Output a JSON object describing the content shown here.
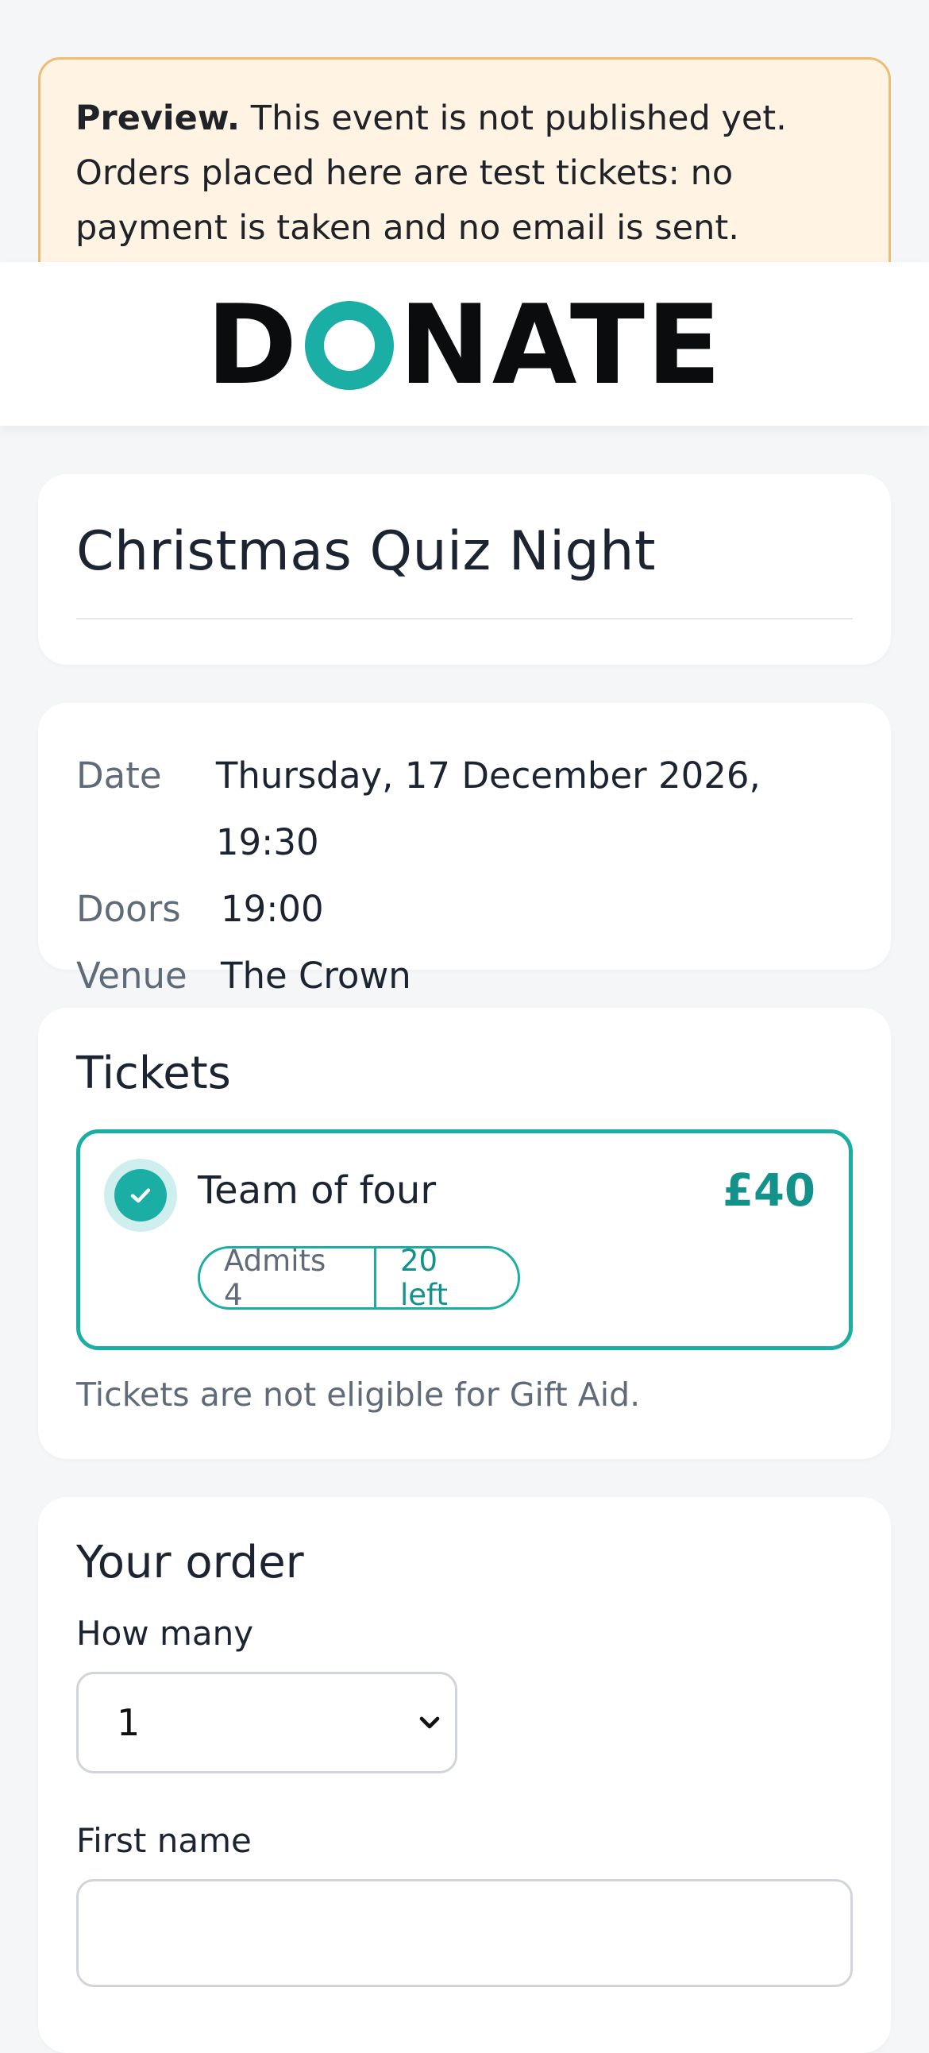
{
  "preview_banner": {
    "label": "Preview.",
    "line1_rest": " This event is not published yet.",
    "line2": "Orders placed here are test tickets: no",
    "line3": "payment is taken and no email is sent."
  },
  "brand": {
    "logo_text": "DONATE",
    "logo_before": "D",
    "logo_after": "NATE",
    "accent_color": "#1aaea5"
  },
  "event": {
    "title": "Christmas Quiz Night",
    "details": [
      {
        "key": "Date",
        "value": "Thursday, 17 December 2026, 19:30"
      },
      {
        "key": "Doors",
        "value": "19:00"
      },
      {
        "key": "Venue",
        "value": "The Crown"
      }
    ]
  },
  "tickets": {
    "heading": "Tickets",
    "options": [
      {
        "name": "Team of four",
        "price": "£40",
        "admits": "Admits 4",
        "remaining": "20 left",
        "selected": true
      }
    ],
    "note": "Tickets are not eligible for Gift Aid."
  },
  "order": {
    "heading": "Your order",
    "quantity_label": "How many",
    "quantity_value": "1",
    "first_name_label": "First name",
    "first_name_value": ""
  },
  "icons": {
    "selected_check": "check-icon",
    "select_arrow": "chevron-down-icon"
  }
}
